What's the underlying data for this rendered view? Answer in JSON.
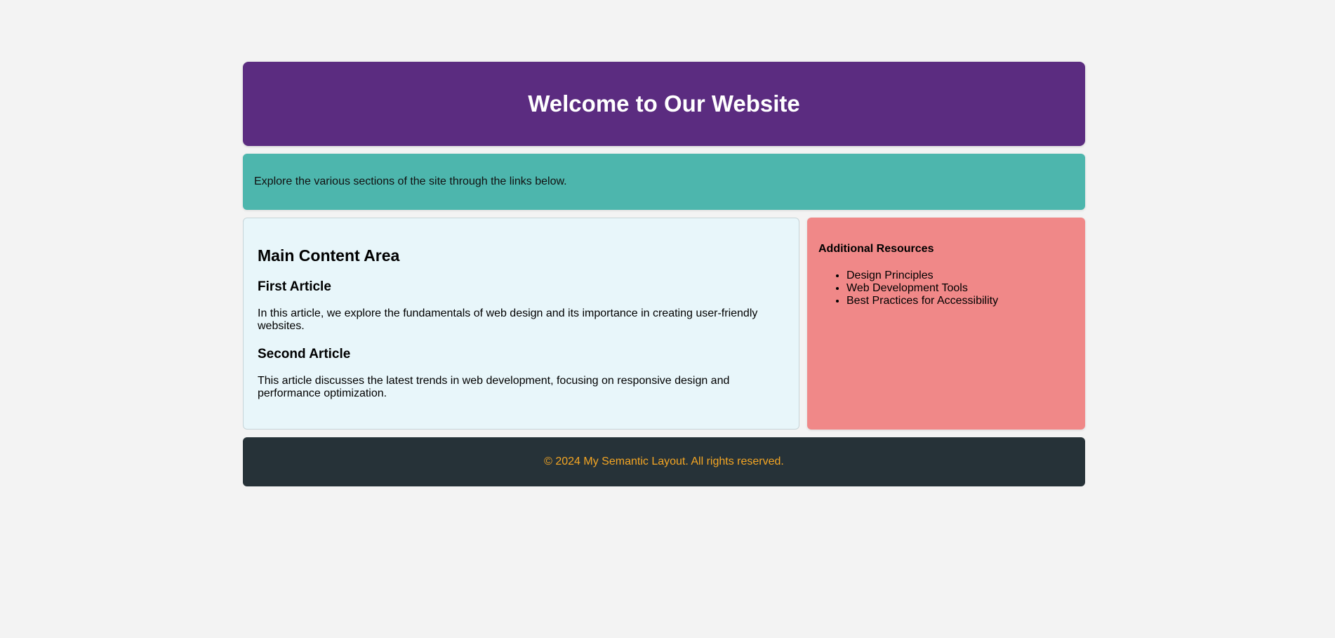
{
  "header": {
    "title": "Welcome to Our Website"
  },
  "nav": {
    "text": "Explore the various sections of the site through the links below."
  },
  "main": {
    "heading": "Main Content Area",
    "articles": [
      {
        "title": "First Article",
        "body": "In this article, we explore the fundamentals of web design and its importance in creating user-friendly websites."
      },
      {
        "title": "Second Article",
        "body": "This article discusses the latest trends in web development, focusing on responsive design and performance optimization."
      }
    ]
  },
  "aside": {
    "heading": "Additional Resources",
    "items": [
      "Design Principles",
      "Web Development Tools",
      "Best Practices for Accessibility"
    ]
  },
  "footer": {
    "text": "© 2024 My Semantic Layout. All rights reserved."
  },
  "colors": {
    "header_bg": "#5b2c80",
    "nav_bg": "#4db6ad",
    "main_bg": "#e8f6fa",
    "aside_bg": "#f08888",
    "footer_bg": "#263238",
    "footer_text": "#f5a623"
  }
}
